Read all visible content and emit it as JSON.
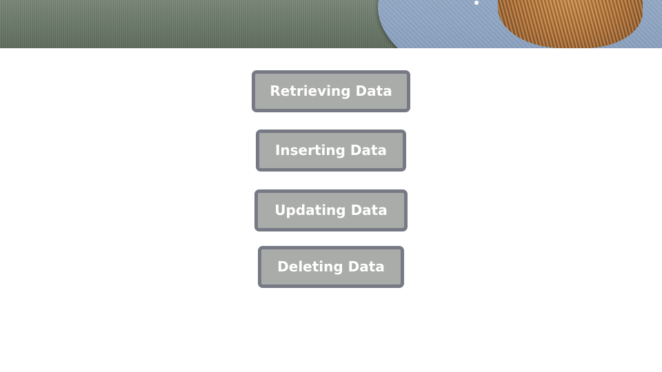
{
  "banner": {
    "image": "photo-banner"
  },
  "menu": {
    "buttons": [
      {
        "label": "Retrieving Data"
      },
      {
        "label": "Inserting Data"
      },
      {
        "label": "Updating Data"
      },
      {
        "label": "Deleting Data"
      }
    ],
    "button_color": "#a9aca8",
    "button_border_color": "#777a85",
    "text_color": "#ffffff"
  }
}
